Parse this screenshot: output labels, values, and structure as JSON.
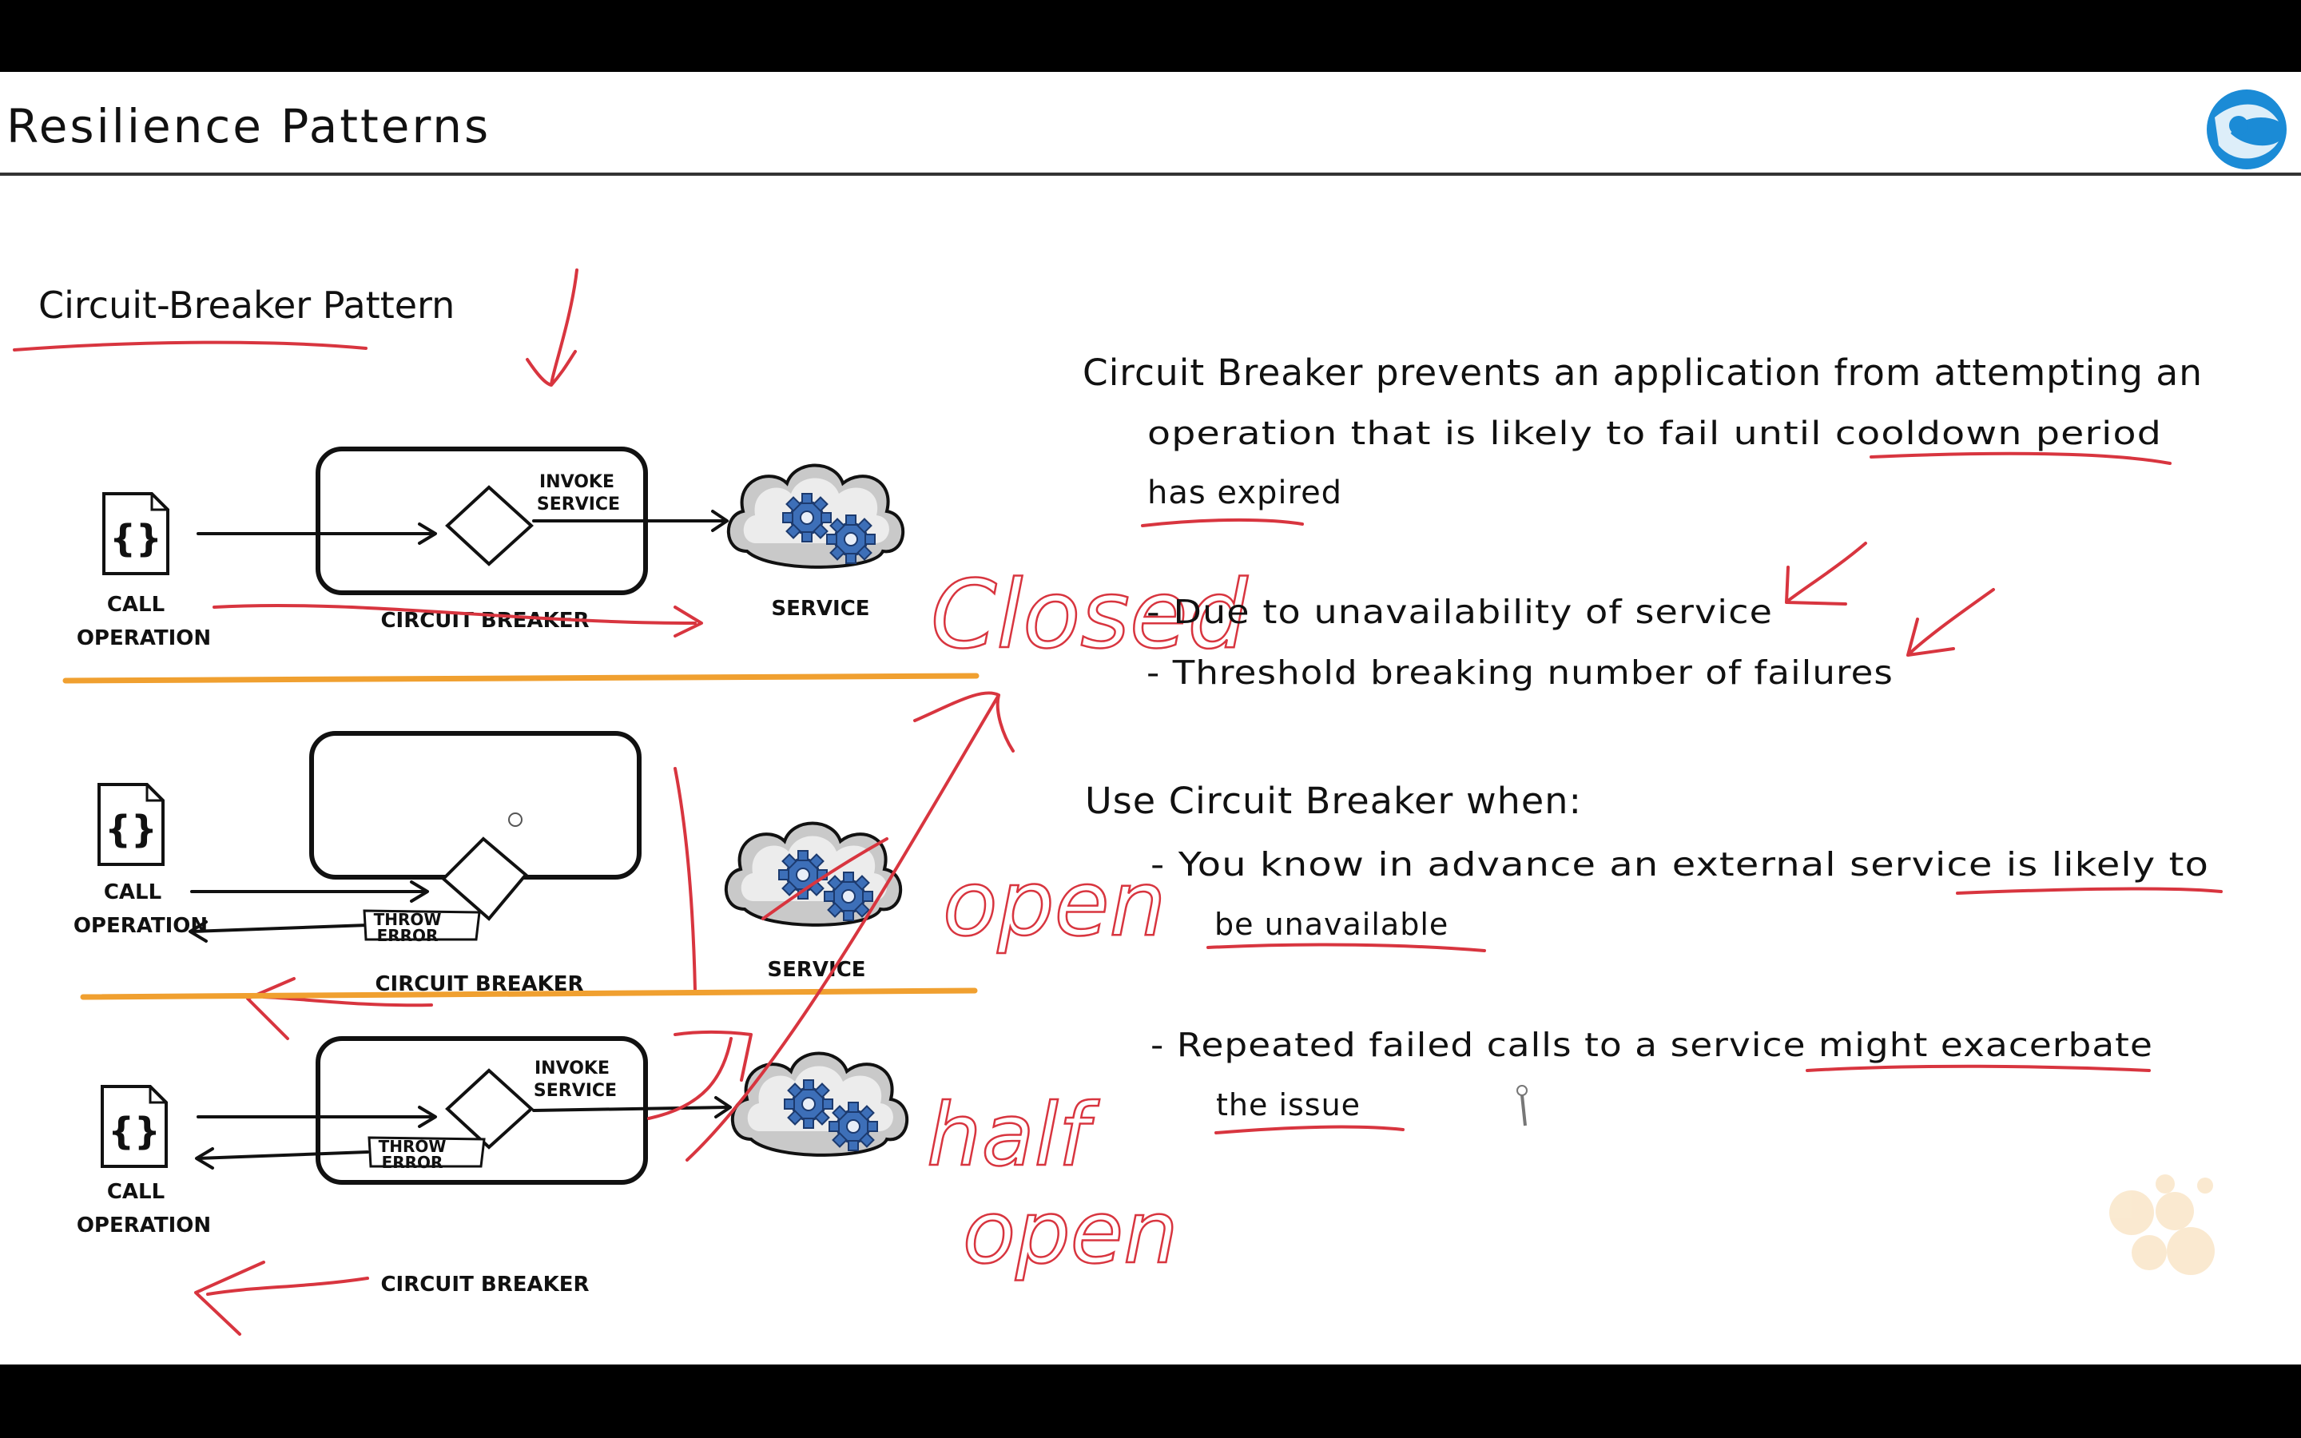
{
  "title": "Resilience Patterns",
  "logo": {
    "icon": "azure-globe-icon",
    "color": "#1b8bd6"
  },
  "diagram": {
    "heading": "Circuit-Breaker Pattern",
    "rows": [
      {
        "call_label_line1": "CALL",
        "call_label_line2": "OPERATION",
        "breaker_label": "CIRCUIT BREAKER",
        "invoke_line1": "INVOKE",
        "invoke_line2": "SERVICE",
        "service_label": "SERVICE",
        "state_annotation": "Closed"
      },
      {
        "call_label_line1": "CALL",
        "call_label_line2": "OPERATION",
        "breaker_label": "CIRCUIT BREAKER",
        "throw_line1": "THROW",
        "throw_line2": "ERROR",
        "service_label": "SERVICE",
        "state_annotation": "open"
      },
      {
        "call_label_line1": "CALL",
        "call_label_line2": "OPERATION",
        "breaker_label": "CIRCUIT BREAKER",
        "invoke_line1": "INVOKE",
        "invoke_line2": "SERVICE",
        "throw_line1": "THROW",
        "throw_line2": "ERROR",
        "state_annotation_line1": "half",
        "state_annotation_line2": "open"
      }
    ]
  },
  "notes": {
    "intro_line1": "Circuit Breaker prevents an application from attempting an",
    "intro_line2": "operation that is likely to fail until cooldown period",
    "intro_line3": "has expired",
    "reasons": [
      "- Due to unavailability of service",
      "- Threshold breaking number of failures"
    ],
    "use_heading": "Use Circuit Breaker when:",
    "use_items": [
      {
        "line1": "- You know in advance an external service is likely to",
        "line2": "be unavailable"
      },
      {
        "line1": "- Repeated failed calls to a service might exacerbate",
        "line2": "the issue"
      }
    ]
  },
  "colors": {
    "annotation_red": "#d8353f",
    "divider_orange": "#f0a030",
    "gear_blue": "#3d6fb8"
  }
}
